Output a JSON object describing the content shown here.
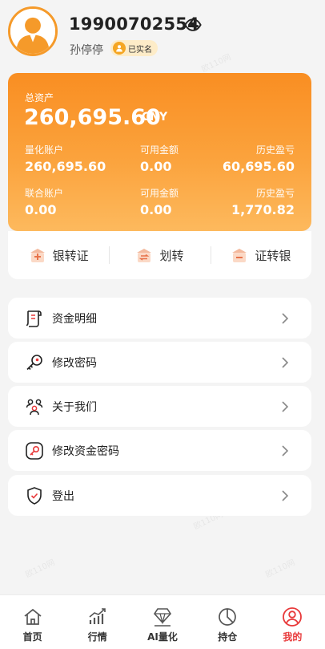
{
  "profile": {
    "phone": "19900702554",
    "name": "孙停停",
    "verified_label": "已实名"
  },
  "assets": {
    "total_label": "总资产",
    "total_value": "260,695.60",
    "currency": "CNY",
    "quant": {
      "account_label": "量化账户",
      "account_value": "260,695.60",
      "available_label": "可用金额",
      "available_value": "0.00",
      "pnl_label": "历史盈亏",
      "pnl_value": "60,695.60"
    },
    "joint": {
      "account_label": "联合账户",
      "account_value": "0.00",
      "available_label": "可用金额",
      "available_value": "0.00",
      "pnl_label": "历史盈亏",
      "pnl_value": "1,770.82"
    }
  },
  "transfer": {
    "bank_to_sec": "银转证",
    "transfer": "划转",
    "sec_to_bank": "证转银"
  },
  "menu": [
    {
      "label": "资金明细",
      "icon": "receipt-icon"
    },
    {
      "label": "修改密码",
      "icon": "key-icon"
    },
    {
      "label": "关于我们",
      "icon": "team-icon"
    },
    {
      "label": "修改资金密码",
      "icon": "key-lock-icon"
    },
    {
      "label": "登出",
      "icon": "shield-icon"
    }
  ],
  "tabs": [
    {
      "label": "首页",
      "icon": "home-icon"
    },
    {
      "label": "行情",
      "icon": "market-icon"
    },
    {
      "label": "AI量化",
      "icon": "ai-quant-icon"
    },
    {
      "label": "持仓",
      "icon": "position-icon"
    },
    {
      "label": "我的",
      "icon": "profile-icon"
    }
  ],
  "active_tab": "我的",
  "watermark": "欧110网",
  "colors": {
    "accent": "#f98e22",
    "active_tab": "#e8393a",
    "background": "#f4f4f4"
  }
}
